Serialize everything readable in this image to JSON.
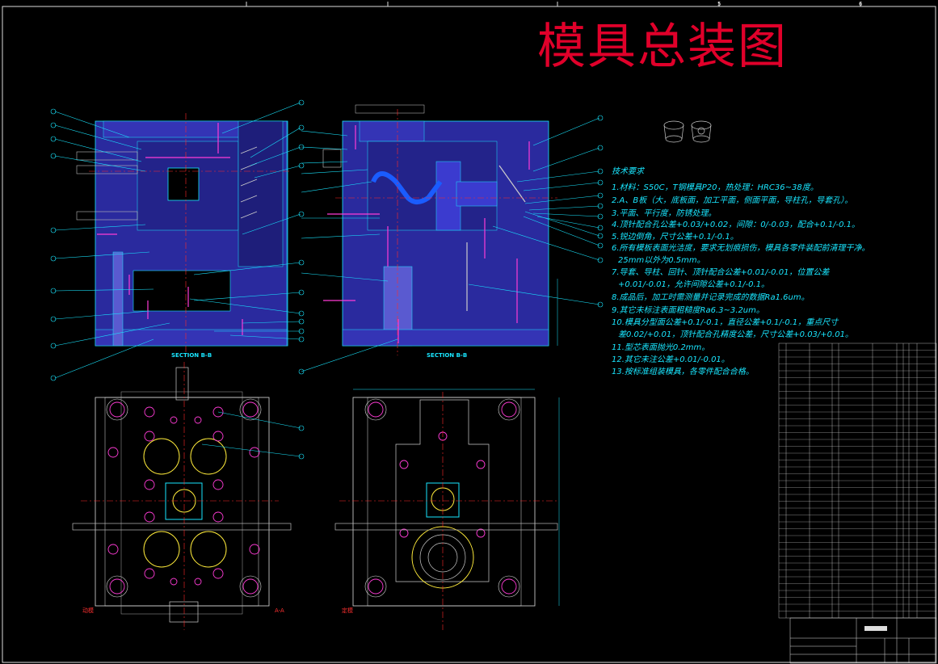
{
  "drawing": {
    "title": "模具总装图",
    "border_zones": [
      "5",
      "6"
    ],
    "section_labels": [
      "SECTION B-B",
      "SECTION B-B"
    ],
    "view_labels": [
      "动模",
      "定模",
      "A-A"
    ],
    "notes_heading": "技术要求",
    "notes": [
      "1.材料：S50C，T钢模具P20，热处理：HRC36~38度。",
      "2.A、B板（大，底板面，加工平面，侧面平面，导柱孔，导套孔）。",
      "3.平面、平行度，防锈处理。",
      "4.顶针配合孔公差+0.03/+0.02，间隙：0/-0.03，配合+0.1/-0.1。",
      "5.锐边倒角，尺寸公差+0.1/-0.1。",
      "6.所有模板表面光洁度，要求无划痕损伤，模具各零件装配前清理干净。",
      "25mm以外为0.5mm。",
      "7.导套、导柱、回针、顶针配合公差+0.01/-0.01，位置公差",
      "+0.01/-0.01，允许间隙公差+0.1/-0.1。",
      "8.成品后，加工时需测量并记录完成的数据Ra1.6um。",
      "9.其它未标注表面粗糙度Ra6.3~3.2um。",
      "10.模具分型面公差+0.1/-0.1，直径公差+0.1/-0.1，重点尺寸",
      "差0.02/+0.01，顶针配合孔精度公差，尺寸公差+0.03/+0.01。",
      "11.型芯表面抛光0.2mm。",
      "12.其它未注公差+0.01/-0.01。",
      "13.按标准组装模具，各零件配合合格。"
    ]
  }
}
